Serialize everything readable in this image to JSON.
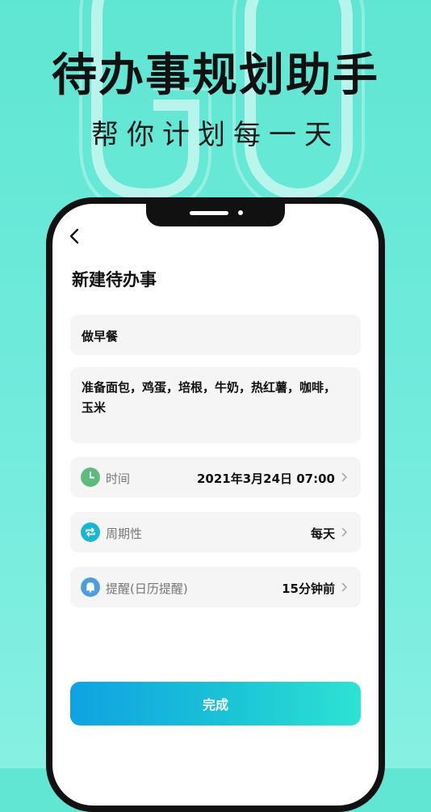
{
  "hero": {
    "title": "待办事规划助手",
    "subtitle": "帮你计划每一天"
  },
  "screen": {
    "page_title": "新建待办事",
    "task_title": "做早餐",
    "task_description": "准备面包，鸡蛋，培根，牛奶，热红薯，咖啡，玉米",
    "rows": [
      {
        "label": "时间",
        "value": "2021年3月24日 07:00",
        "icon": "clock-icon",
        "icon_color": "#5dbb7e"
      },
      {
        "label": "周期性",
        "value": "每天",
        "icon": "repeat-icon",
        "icon_color": "#17b7d3"
      },
      {
        "label": "提醒(日历提醒)",
        "value": "15分钟前",
        "icon": "bell-icon",
        "icon_color": "#4b9ddf"
      }
    ],
    "done_label": "完成"
  },
  "colors": {
    "background": "#6eeadb",
    "button_start": "#0fa2e2",
    "button_end": "#2de3d3"
  }
}
